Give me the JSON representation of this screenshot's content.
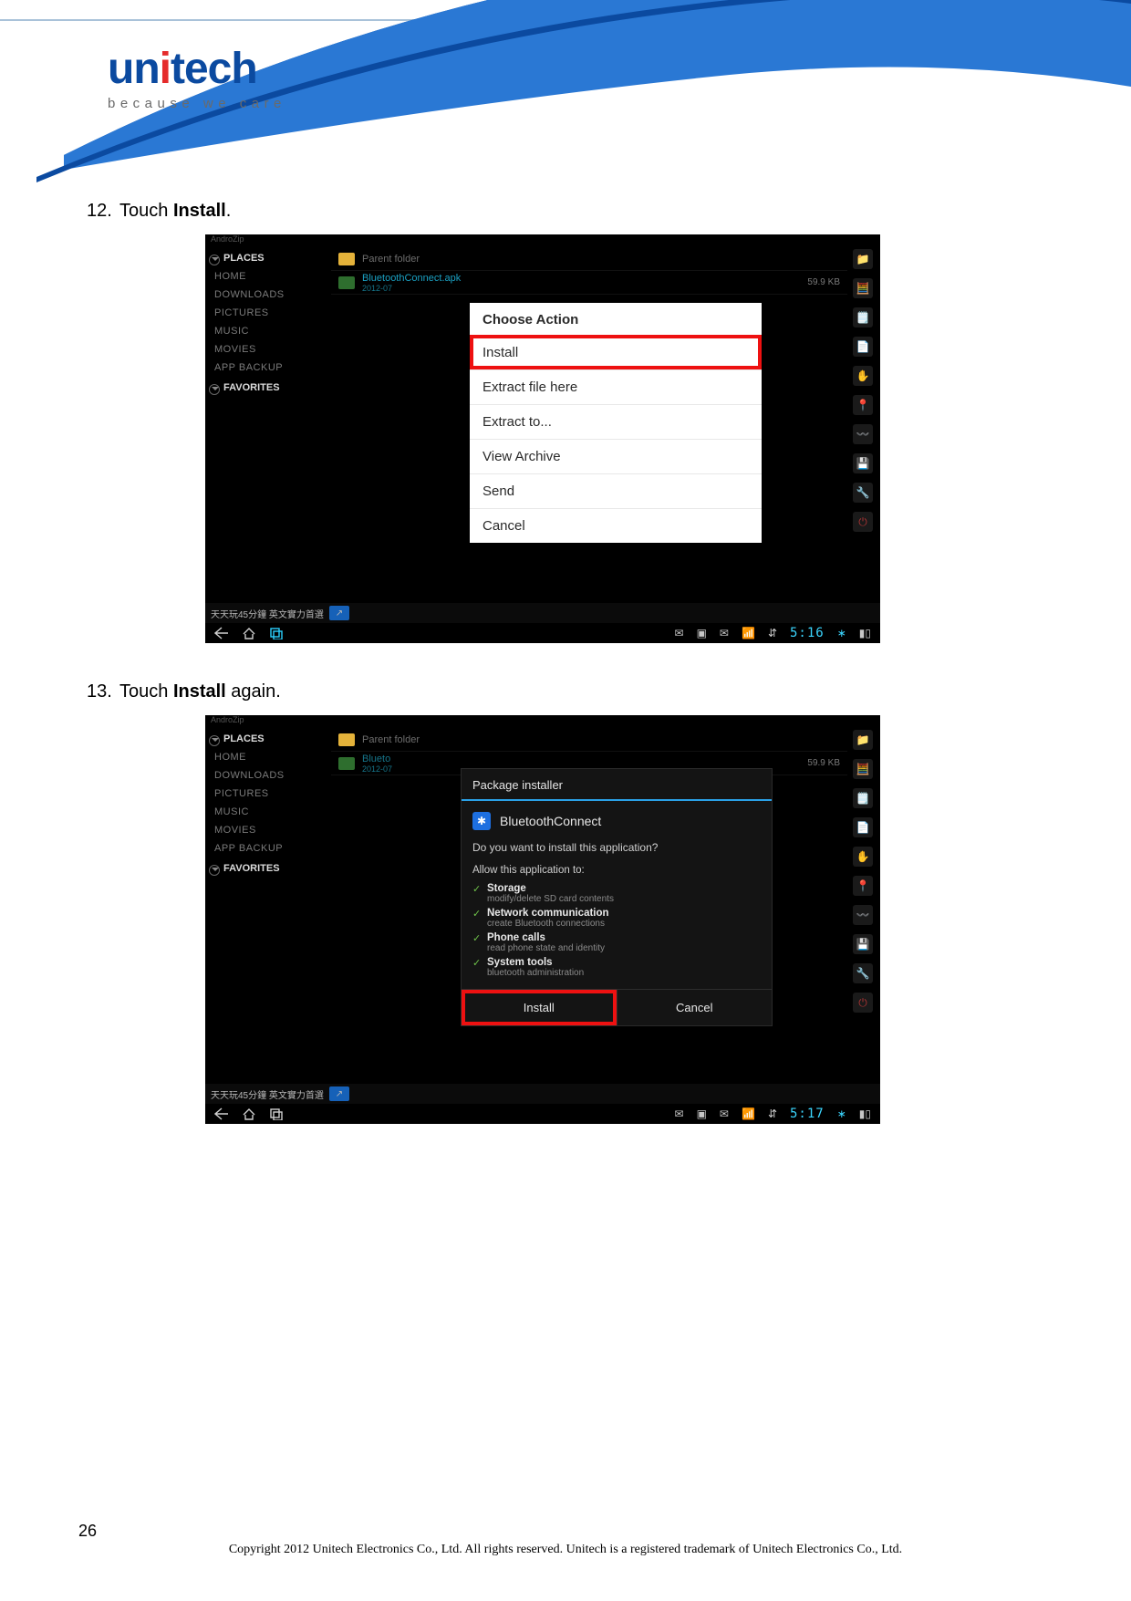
{
  "brand": {
    "name": "unitech",
    "tagline": "because we care"
  },
  "steps": {
    "s12": {
      "num": "12.",
      "pre": "Touch ",
      "bold": "Install",
      "post": "."
    },
    "s13": {
      "num": "13.",
      "pre": "Touch ",
      "bold": "Install",
      "post": " again."
    }
  },
  "androzip_label": "AndroZip",
  "sidebar": {
    "group_places": "PLACES",
    "group_favorites": "FAVORITES",
    "items": [
      "HOME",
      "DOWNLOADS",
      "PICTURES",
      "MUSIC",
      "MOVIES",
      "APP BACKUP"
    ]
  },
  "files": {
    "parent": "Parent folder",
    "apk_name": "BluetoothConnect.apk",
    "apk_date": "2012-07",
    "apk_size": "59.9 KB"
  },
  "action_sheet": {
    "title": "Choose Action",
    "items": [
      "Install",
      "Extract file here",
      "Extract to...",
      "View Archive",
      "Send",
      "Cancel"
    ]
  },
  "installer": {
    "title": "Package installer",
    "app_name": "BluetoothConnect",
    "question": "Do you want to install this application?",
    "allow": "Allow this application to:",
    "perms": [
      {
        "t": "Storage",
        "s": "modify/delete SD card contents"
      },
      {
        "t": "Network communication",
        "s": "create Bluetooth connections"
      },
      {
        "t": "Phone calls",
        "s": "read phone state and identity"
      },
      {
        "t": "System tools",
        "s": "bluetooth administration"
      }
    ],
    "btn_install": "Install",
    "btn_cancel": "Cancel"
  },
  "taskbar": {
    "text": "天天玩45分鐘 英文實力首選"
  },
  "clock": {
    "s1": "5:16",
    "s2": "5:17"
  },
  "footer": {
    "page": "26",
    "copyright": "Copyright 2012 Unitech Electronics Co., Ltd. All rights reserved. Unitech is a registered trademark of Unitech Electronics Co., Ltd."
  }
}
